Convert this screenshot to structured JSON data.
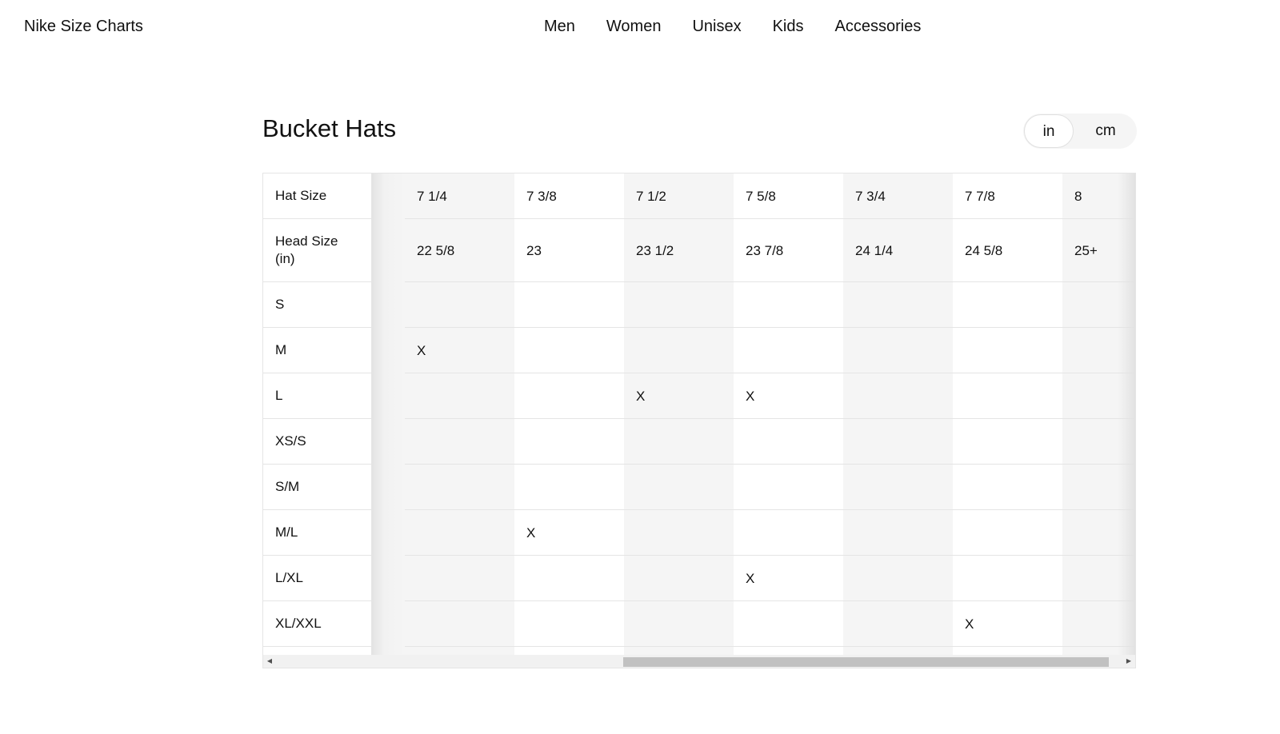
{
  "header": {
    "brand": "Nike Size Charts",
    "nav": [
      "Men",
      "Women",
      "Unisex",
      "Kids",
      "Accessories"
    ]
  },
  "page": {
    "title": "Bucket Hats",
    "units": {
      "in": "in",
      "cm": "cm",
      "selected": "in"
    }
  },
  "table": {
    "row_labels": [
      "Hat Size",
      "Head Size (in)",
      "S",
      "M",
      "L",
      "XS/S",
      "S/M",
      "M/L",
      "L/XL",
      "XL/XXL"
    ],
    "columns": [
      {
        "hat_size": "7 1/4",
        "head_size": "22 5/8"
      },
      {
        "hat_size": "7 3/8",
        "head_size": "23"
      },
      {
        "hat_size": "7 1/2",
        "head_size": "23 1/2"
      },
      {
        "hat_size": "7 5/8",
        "head_size": "23 7/8"
      },
      {
        "hat_size": "7 3/4",
        "head_size": "24 1/4"
      },
      {
        "hat_size": "7 7/8",
        "head_size": "24 5/8"
      },
      {
        "hat_size": "8",
        "head_size": "25+"
      }
    ],
    "marks": {
      "S": [
        "",
        "",
        "",
        "",
        "",
        "",
        ""
      ],
      "M": [
        "X",
        "",
        "",
        "",
        "",
        "",
        ""
      ],
      "L": [
        "",
        "",
        "X",
        "X",
        "",
        "",
        ""
      ],
      "XS/S": [
        "",
        "",
        "",
        "",
        "",
        "",
        ""
      ],
      "S/M": [
        "",
        "",
        "",
        "",
        "",
        "",
        ""
      ],
      "M/L": [
        "",
        "X",
        "",
        "",
        "",
        "",
        ""
      ],
      "L/XL": [
        "",
        "",
        "",
        "X",
        "",
        "",
        ""
      ],
      "XL/XXL": [
        "",
        "",
        "",
        "",
        "",
        "X",
        ""
      ]
    }
  },
  "colors": {
    "text": "#111111",
    "shade": "#f5f5f5",
    "border": "#e5e5e5",
    "scroll_thumb": "#c1c1c1"
  },
  "icons": {
    "scroll_left": "◀",
    "scroll_right": "▶"
  }
}
